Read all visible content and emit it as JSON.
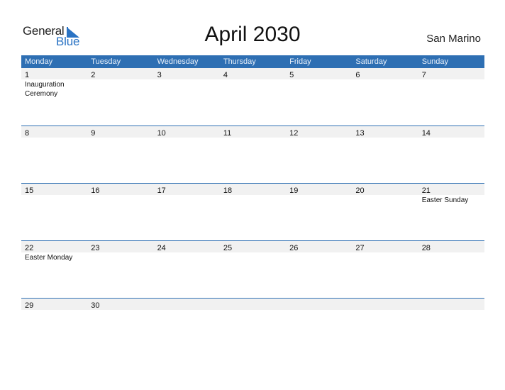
{
  "logo": {
    "part1": "General",
    "part2": "Blue"
  },
  "title": "April 2030",
  "country": "San Marino",
  "colors": {
    "header_bg": "#2e6fb3",
    "date_strip_bg": "#f1f1f1",
    "brand": "#2a73c4"
  },
  "weekdays": [
    "Monday",
    "Tuesday",
    "Wednesday",
    "Thursday",
    "Friday",
    "Saturday",
    "Sunday"
  ],
  "weeks": [
    {
      "days": [
        "1",
        "2",
        "3",
        "4",
        "5",
        "6",
        "7"
      ],
      "events": [
        "Inauguration Ceremony",
        "",
        "",
        "",
        "",
        "",
        ""
      ]
    },
    {
      "days": [
        "8",
        "9",
        "10",
        "11",
        "12",
        "13",
        "14"
      ],
      "events": [
        "",
        "",
        "",
        "",
        "",
        "",
        ""
      ]
    },
    {
      "days": [
        "15",
        "16",
        "17",
        "18",
        "19",
        "20",
        "21"
      ],
      "events": [
        "",
        "",
        "",
        "",
        "",
        "",
        "Easter Sunday"
      ]
    },
    {
      "days": [
        "22",
        "23",
        "24",
        "25",
        "26",
        "27",
        "28"
      ],
      "events": [
        "Easter Monday",
        "",
        "",
        "",
        "",
        "",
        ""
      ]
    },
    {
      "days": [
        "29",
        "30",
        "",
        "",
        "",
        "",
        ""
      ],
      "events": [
        "",
        "",
        "",
        "",
        "",
        "",
        ""
      ]
    }
  ]
}
